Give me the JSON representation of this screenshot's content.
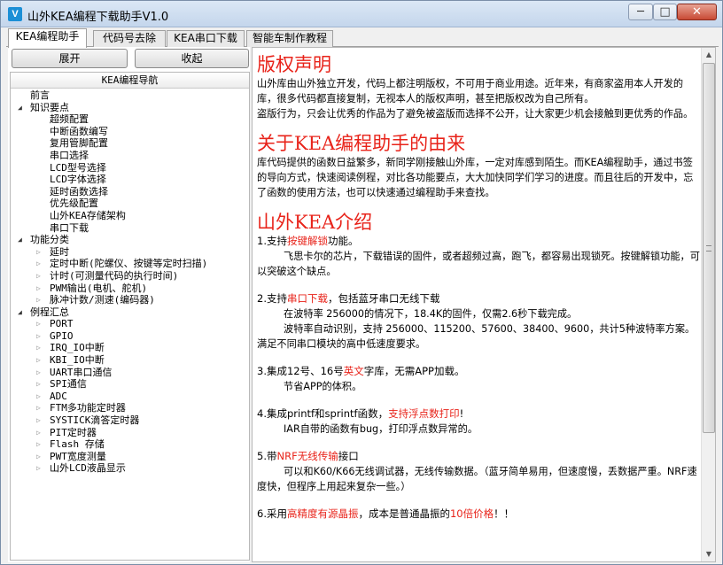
{
  "window": {
    "title": "山外KEA编程下载助手V1.0",
    "icon_glyph": "V",
    "controls": {
      "minimize": "─",
      "maximize": "□",
      "close": "✕"
    }
  },
  "tabs": [
    {
      "label": "KEA编程助手",
      "active": true
    },
    {
      "label": "代码号去除",
      "active": false
    },
    {
      "label": "KEA串口下载",
      "active": false
    },
    {
      "label": "智能车制作教程",
      "active": false
    }
  ],
  "buttons": {
    "expand": "展开",
    "collapse": "收起"
  },
  "tree": {
    "header": "KEA编程导航",
    "item_preface": "前言",
    "group_knowledge": "知识要点",
    "knowledge": [
      "超频配置",
      "中断函数编写",
      "复用管脚配置",
      "串口选择",
      "LCD型号选择",
      "LCD字体选择",
      "延时函数选择",
      "优先级配置",
      "山外KEA存储架构",
      "串口下载"
    ],
    "group_function": "功能分类",
    "function": [
      "延时",
      "定时中断(陀螺仪、按键等定时扫描)",
      "计时(可测量代码的执行时间)",
      "PWM输出(电机、舵机)",
      "脉冲计数/测速(编码器)"
    ],
    "group_examples": "例程汇总",
    "examples": [
      "PORT",
      "GPIO",
      "IRQ_IO中断",
      "KBI_IO中断",
      "UART串口通信",
      "SPI通信",
      "ADC",
      "FTM多功能定时器",
      "SYSTICK滴答定时器",
      "PIT定时器",
      "Flash 存储",
      "PWT宽度测量",
      "山外LCD液晶显示"
    ]
  },
  "content": {
    "h_copyright": "版权声明",
    "copyright_p1": "山外库由山外独立开发，代码上都注明版权，不可用于商业用途。近年来，有商家盗用本人开发的库，很多代码都直接复制，无视本人的版权声明，甚至把版权改为自己所有。",
    "copyright_p2": "盗版行为，只会让优秀的作品为了避免被盗版而选择不公开，让大家更少机会接触到更优秀的作品。",
    "h_origin": "关于KEA编程助手的由来",
    "origin_p": "库代码提供的函数日益繁多，新同学刚接触山外库，一定对库感到陌生。而KEA编程助手，通过书签的导向方式，快速阅读例程，对比各功能要点，大大加快同学们学习的进度。而且往后的开发中，忘了函数的使用方法，也可以快速通过编程助手来查找。",
    "h_intro": "山外KEA介绍",
    "i1_pre": "1.支持",
    "i1_red": "按键解锁",
    "i1_post": "功能。",
    "i1_body": "飞思卡尔的芯片，下载错误的固件，或者超频过高，跑飞，都容易出现锁死。按键解锁功能，可以突破这个缺点。",
    "i2_pre": "2.支持",
    "i2_red": "串口下载",
    "i2_post": "，包括蓝牙串口无线下载",
    "i2_body1": "在波特率 256000的情况下，18.4K的固件，仅需2.6秒下载完成。",
    "i2_body2": "波特率自动识别，支持 256000、115200、57600、38400、9600，共计5种波特率方案。满足不同串口模块的高中低速度要求。",
    "i3_pre": "3.集成12号、16号",
    "i3_red": "英文",
    "i3_post": "字库，无需APP加载。",
    "i3_body": "节省APP的体积。",
    "i4_pre": "4.集成printf和sprintf函数，",
    "i4_red": "支持浮点数打印",
    "i4_post": "!",
    "i4_body": "IAR自带的函数有bug，打印浮点数异常的。",
    "i5_pre": "5.带",
    "i5_red": "NRF无线传输",
    "i5_post": "接口",
    "i5_body": "可以和K60/K66无线调试器，无线传输数据。（蓝牙简单易用，但速度慢，丢数据严重。NRF速度快，但程序上用起来复杂一些。）",
    "i6_pre": "6.采用",
    "i6_red": "高精度有源晶振",
    "i6_mid": "，成本是普通晶振的",
    "i6_red2": "10倍价格",
    "i6_post": "！！"
  },
  "scrollbar": {
    "up": "▲",
    "down": "▼"
  }
}
